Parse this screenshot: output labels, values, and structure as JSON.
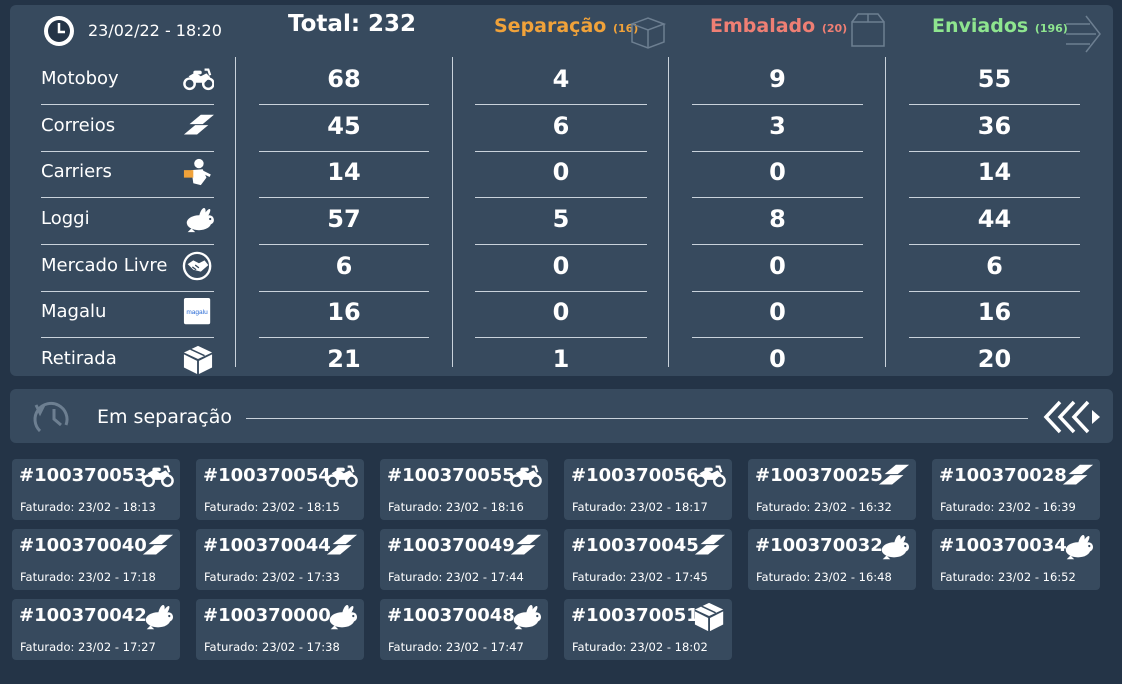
{
  "header": {
    "datetime": "23/02/22 - 18:20",
    "total": "Total: 232",
    "columns": [
      {
        "label": "Separação",
        "count": "(16)",
        "color": "#f0a23a",
        "icon": "box-open-icon"
      },
      {
        "label": "Embalado",
        "count": "(20)",
        "color": "#ef7f74",
        "icon": "box-closed-icon"
      },
      {
        "label": "Enviados",
        "count": "(196)",
        "color": "#8ee58f",
        "icon": "arrows-right-icon"
      }
    ]
  },
  "carriers": [
    {
      "name": "Motoboy",
      "icon": "motorcycle-icon",
      "total": "68",
      "separacao": "4",
      "embalado": "9",
      "enviados": "55"
    },
    {
      "name": "Correios",
      "icon": "correios-icon",
      "total": "45",
      "separacao": "6",
      "embalado": "3",
      "enviados": "36"
    },
    {
      "name": "Carriers",
      "icon": "courier-icon",
      "total": "14",
      "separacao": "0",
      "embalado": "0",
      "enviados": "14"
    },
    {
      "name": "Loggi",
      "icon": "rabbit-icon",
      "total": "57",
      "separacao": "5",
      "embalado": "8",
      "enviados": "44"
    },
    {
      "name": "Mercado Livre",
      "icon": "handshake-icon",
      "total": "6",
      "separacao": "0",
      "embalado": "0",
      "enviados": "6"
    },
    {
      "name": "Magalu",
      "icon": "magalu-icon",
      "icon_text": "magalu",
      "total": "16",
      "separacao": "0",
      "embalado": "0",
      "enviados": "16"
    },
    {
      "name": "Retirada",
      "icon": "box-icon",
      "total": "21",
      "separacao": "1",
      "embalado": "0",
      "enviados": "20"
    }
  ],
  "section": {
    "title": "Em separação",
    "icon": "refresh-clock-icon",
    "nav_icon": "chevrons-left-icon"
  },
  "orders": [
    {
      "id": "#100370053",
      "date": "Faturado: 23/02 - 18:13",
      "icon": "motorcycle-icon"
    },
    {
      "id": "#100370054",
      "date": "Faturado: 23/02 - 18:15",
      "icon": "motorcycle-icon"
    },
    {
      "id": "#100370055",
      "date": "Faturado: 23/02 - 18:16",
      "icon": "motorcycle-icon"
    },
    {
      "id": "#100370056",
      "date": "Faturado: 23/02 - 18:17",
      "icon": "motorcycle-icon"
    },
    {
      "id": "#100370025",
      "date": "Faturado: 23/02 - 16:32",
      "icon": "correios-icon"
    },
    {
      "id": "#100370028",
      "date": "Faturado: 23/02 - 16:39",
      "icon": "correios-icon"
    },
    {
      "id": "#100370040",
      "date": "Faturado: 23/02 - 17:18",
      "icon": "correios-icon"
    },
    {
      "id": "#100370044",
      "date": "Faturado: 23/02 - 17:33",
      "icon": "correios-icon"
    },
    {
      "id": "#100370049",
      "date": "Faturado: 23/02 - 17:44",
      "icon": "correios-icon"
    },
    {
      "id": "#100370045",
      "date": "Faturado: 23/02 - 17:45",
      "icon": "correios-icon"
    },
    {
      "id": "#100370032",
      "date": "Faturado: 23/02 - 16:48",
      "icon": "rabbit-icon"
    },
    {
      "id": "#100370034",
      "date": "Faturado: 23/02 - 16:52",
      "icon": "rabbit-icon"
    },
    {
      "id": "#100370042",
      "date": "Faturado: 23/02 - 17:27",
      "icon": "rabbit-icon"
    },
    {
      "id": "#100370000",
      "date": "Faturado: 23/02 - 17:38",
      "icon": "rabbit-icon"
    },
    {
      "id": "#100370048",
      "date": "Faturado: 23/02 - 17:47",
      "icon": "rabbit-icon"
    },
    {
      "id": "#100370051",
      "date": "Faturado: 23/02 - 18:02",
      "icon": "box-icon"
    }
  ]
}
